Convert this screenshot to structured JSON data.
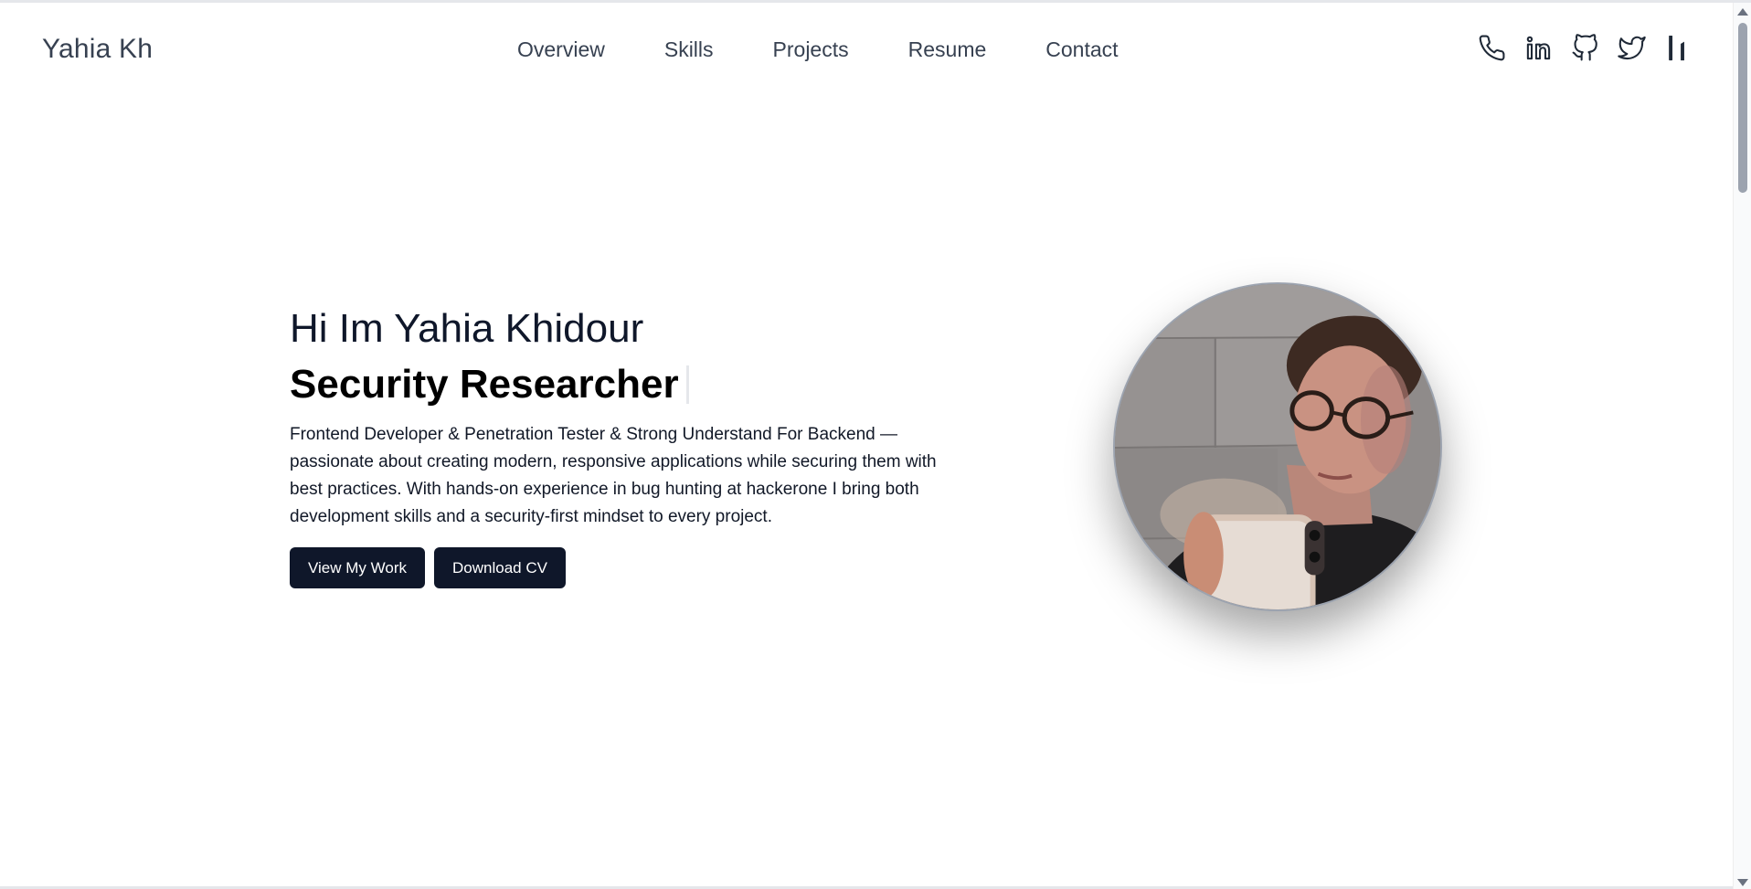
{
  "navbar": {
    "brand": "Yahia Kh",
    "links": [
      {
        "label": "Overview"
      },
      {
        "label": "Skills"
      },
      {
        "label": "Projects"
      },
      {
        "label": "Resume"
      },
      {
        "label": "Contact"
      }
    ],
    "socials": [
      {
        "icon": "phone-icon"
      },
      {
        "icon": "linkedin-icon"
      },
      {
        "icon": "github-icon"
      },
      {
        "icon": "twitter-icon"
      },
      {
        "icon": "hackerone-icon"
      }
    ]
  },
  "hero": {
    "greeting": "Hi Im Yahia Khidour",
    "role": "Security Researcher",
    "bio": "Frontend Developer & Penetration Tester & Strong Understand For Backend — passionate about creating modern, responsive applications while securing them with best practices. With hands-on experience in bug hunting at hackerone I bring both development skills and a security-first mindset to every project.",
    "primary_button": "View My Work",
    "secondary_button": "Download CV"
  },
  "colors": {
    "button_bg": "#0f172a",
    "text_dark": "#111827",
    "nav_text": "#374151"
  }
}
